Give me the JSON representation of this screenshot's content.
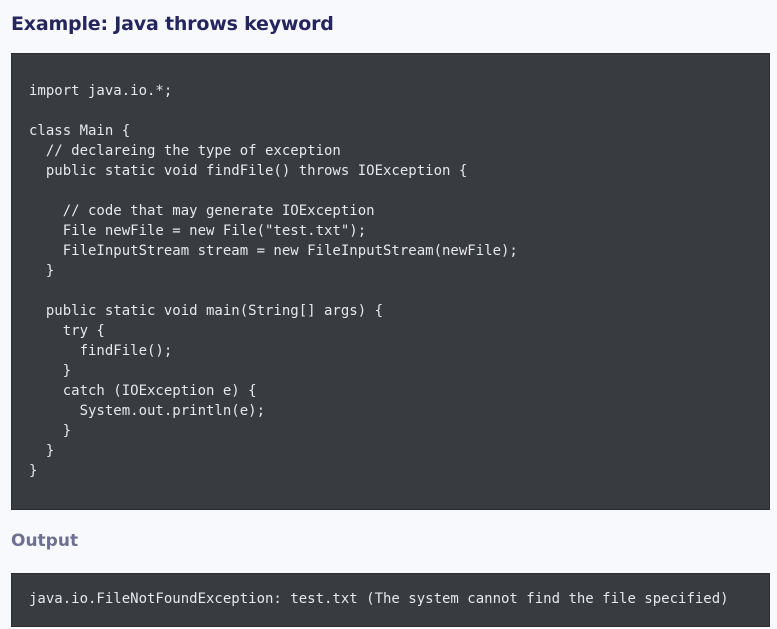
{
  "example": {
    "title": "Example: Java throws keyword",
    "code": "import java.io.*;\n\nclass Main {\n  // declareing the type of exception\n  public static void findFile() throws IOException {\n\n    // code that may generate IOException\n    File newFile = new File(\"test.txt\");\n    FileInputStream stream = new FileInputStream(newFile);\n  }\n\n  public static void main(String[] args) {\n    try {\n      findFile();\n    }\n    catch (IOException e) {\n      System.out.println(e);\n    }\n  }\n}"
  },
  "output": {
    "title": "Output",
    "text": "java.io.FileNotFoundException: test.txt (The system cannot find the file specified)"
  }
}
